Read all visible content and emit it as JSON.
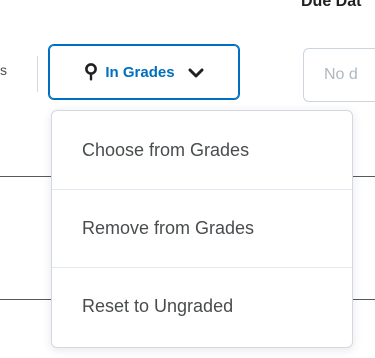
{
  "header": {
    "due_date_label": "Due Dat",
    "left_stub_text": "s"
  },
  "grades_button": {
    "label": "In Grades",
    "icon": "map-pin-icon",
    "chevron_icon": "chevron-down-icon",
    "accent_color": "#006fbf"
  },
  "due_date_input": {
    "placeholder": "No d"
  },
  "dropdown": {
    "items": [
      {
        "label": "Choose from Grades"
      },
      {
        "label": "Remove from Grades"
      },
      {
        "label": "Reset to Ungraded"
      }
    ]
  }
}
